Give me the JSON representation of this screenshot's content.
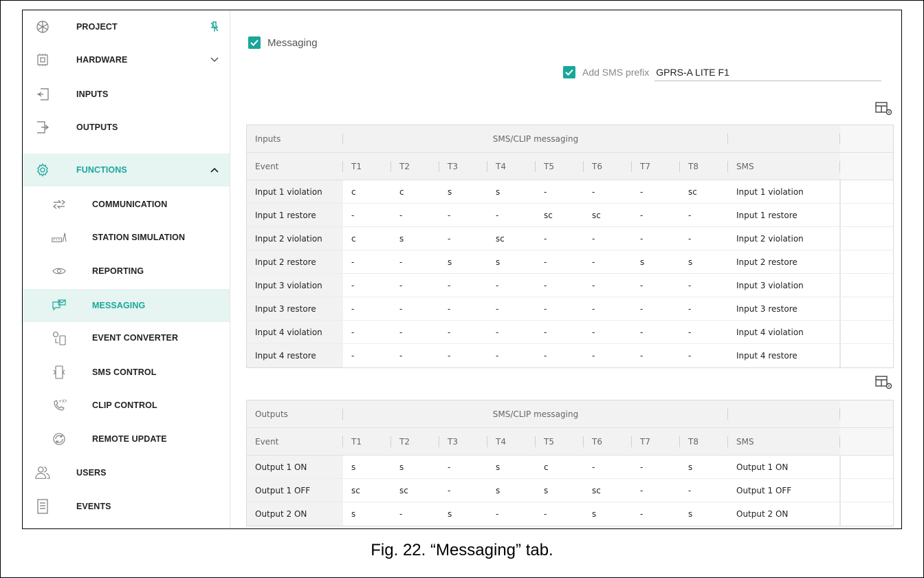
{
  "sidebar": {
    "items": [
      {
        "label": "PROJECT",
        "icon": "snowflake-icon",
        "trailing": "pin-icon"
      },
      {
        "label": "HARDWARE",
        "icon": "chip-icon",
        "trailing": "chevron-down-icon"
      },
      {
        "label": "INPUTS",
        "icon": "input-icon"
      },
      {
        "label": "OUTPUTS",
        "icon": "output-icon"
      },
      {
        "label": "FUNCTIONS",
        "icon": "gear-icon",
        "trailing": "chevron-up-icon"
      },
      {
        "label": "COMMUNICATION",
        "icon": "communication-icon"
      },
      {
        "label": "STATION SIMULATION",
        "icon": "station-icon"
      },
      {
        "label": "REPORTING",
        "icon": "eye-icon"
      },
      {
        "label": "MESSAGING",
        "icon": "message-icon"
      },
      {
        "label": "EVENT CONVERTER",
        "icon": "converter-icon"
      },
      {
        "label": "SMS CONTROL",
        "icon": "sms-control-icon"
      },
      {
        "label": "CLIP CONTROL",
        "icon": "phone-icon"
      },
      {
        "label": "REMOTE UPDATE",
        "icon": "refresh-icon"
      },
      {
        "label": "USERS",
        "icon": "users-icon"
      },
      {
        "label": "EVENTS",
        "icon": "document-icon"
      }
    ]
  },
  "main": {
    "messaging_label": "Messaging",
    "messaging_checked": true,
    "sms_prefix_label": "Add SMS prefix",
    "sms_prefix_checked": true,
    "sms_prefix_value": "GPRS-A LITE F1"
  },
  "inputs_table": {
    "group_headers": [
      "Inputs",
      "SMS/CLIP messaging"
    ],
    "columns": [
      "Event",
      "T1",
      "T2",
      "T3",
      "T4",
      "T5",
      "T6",
      "T7",
      "T8",
      "SMS"
    ],
    "rows": [
      [
        "Input 1 violation",
        "c",
        "c",
        "s",
        "s",
        "-",
        "-",
        "-",
        "sc",
        "Input 1 violation"
      ],
      [
        "Input 1 restore",
        "-",
        "-",
        "-",
        "-",
        "sc",
        "sc",
        "-",
        "-",
        "Input 1 restore"
      ],
      [
        "Input 2 violation",
        "c",
        "s",
        "-",
        "sc",
        "-",
        "-",
        "-",
        "-",
        "Input 2 violation"
      ],
      [
        "Input 2 restore",
        "-",
        "-",
        "s",
        "s",
        "-",
        "-",
        "s",
        "s",
        "Input 2 restore"
      ],
      [
        "Input 3 violation",
        "-",
        "-",
        "-",
        "-",
        "-",
        "-",
        "-",
        "-",
        "Input 3 violation"
      ],
      [
        "Input 3 restore",
        "-",
        "-",
        "-",
        "-",
        "-",
        "-",
        "-",
        "-",
        "Input 3 restore"
      ],
      [
        "Input 4 violation",
        "-",
        "-",
        "-",
        "-",
        "-",
        "-",
        "-",
        "-",
        "Input 4 violation"
      ],
      [
        "Input 4 restore",
        "-",
        "-",
        "-",
        "-",
        "-",
        "-",
        "-",
        "-",
        "Input 4 restore"
      ]
    ]
  },
  "outputs_table": {
    "group_headers": [
      "Outputs",
      "SMS/CLIP messaging"
    ],
    "columns": [
      "Event",
      "T1",
      "T2",
      "T3",
      "T4",
      "T5",
      "T6",
      "T7",
      "T8",
      "SMS"
    ],
    "rows": [
      [
        "Output 1 ON",
        "s",
        "s",
        "-",
        "s",
        "c",
        "-",
        "-",
        "s",
        "Output 1 ON"
      ],
      [
        "Output 1 OFF",
        "sc",
        "sc",
        "-",
        "s",
        "s",
        "sc",
        "-",
        "-",
        "Output 1 OFF"
      ],
      [
        "Output 2 ON",
        "s",
        "-",
        "s",
        "-",
        "-",
        "s",
        "-",
        "s",
        "Output 2 ON"
      ]
    ]
  },
  "caption": "Fig. 22. “Messaging” tab.",
  "colors": {
    "accent": "#1aa79a",
    "active_bg": "#e6f4f2"
  }
}
